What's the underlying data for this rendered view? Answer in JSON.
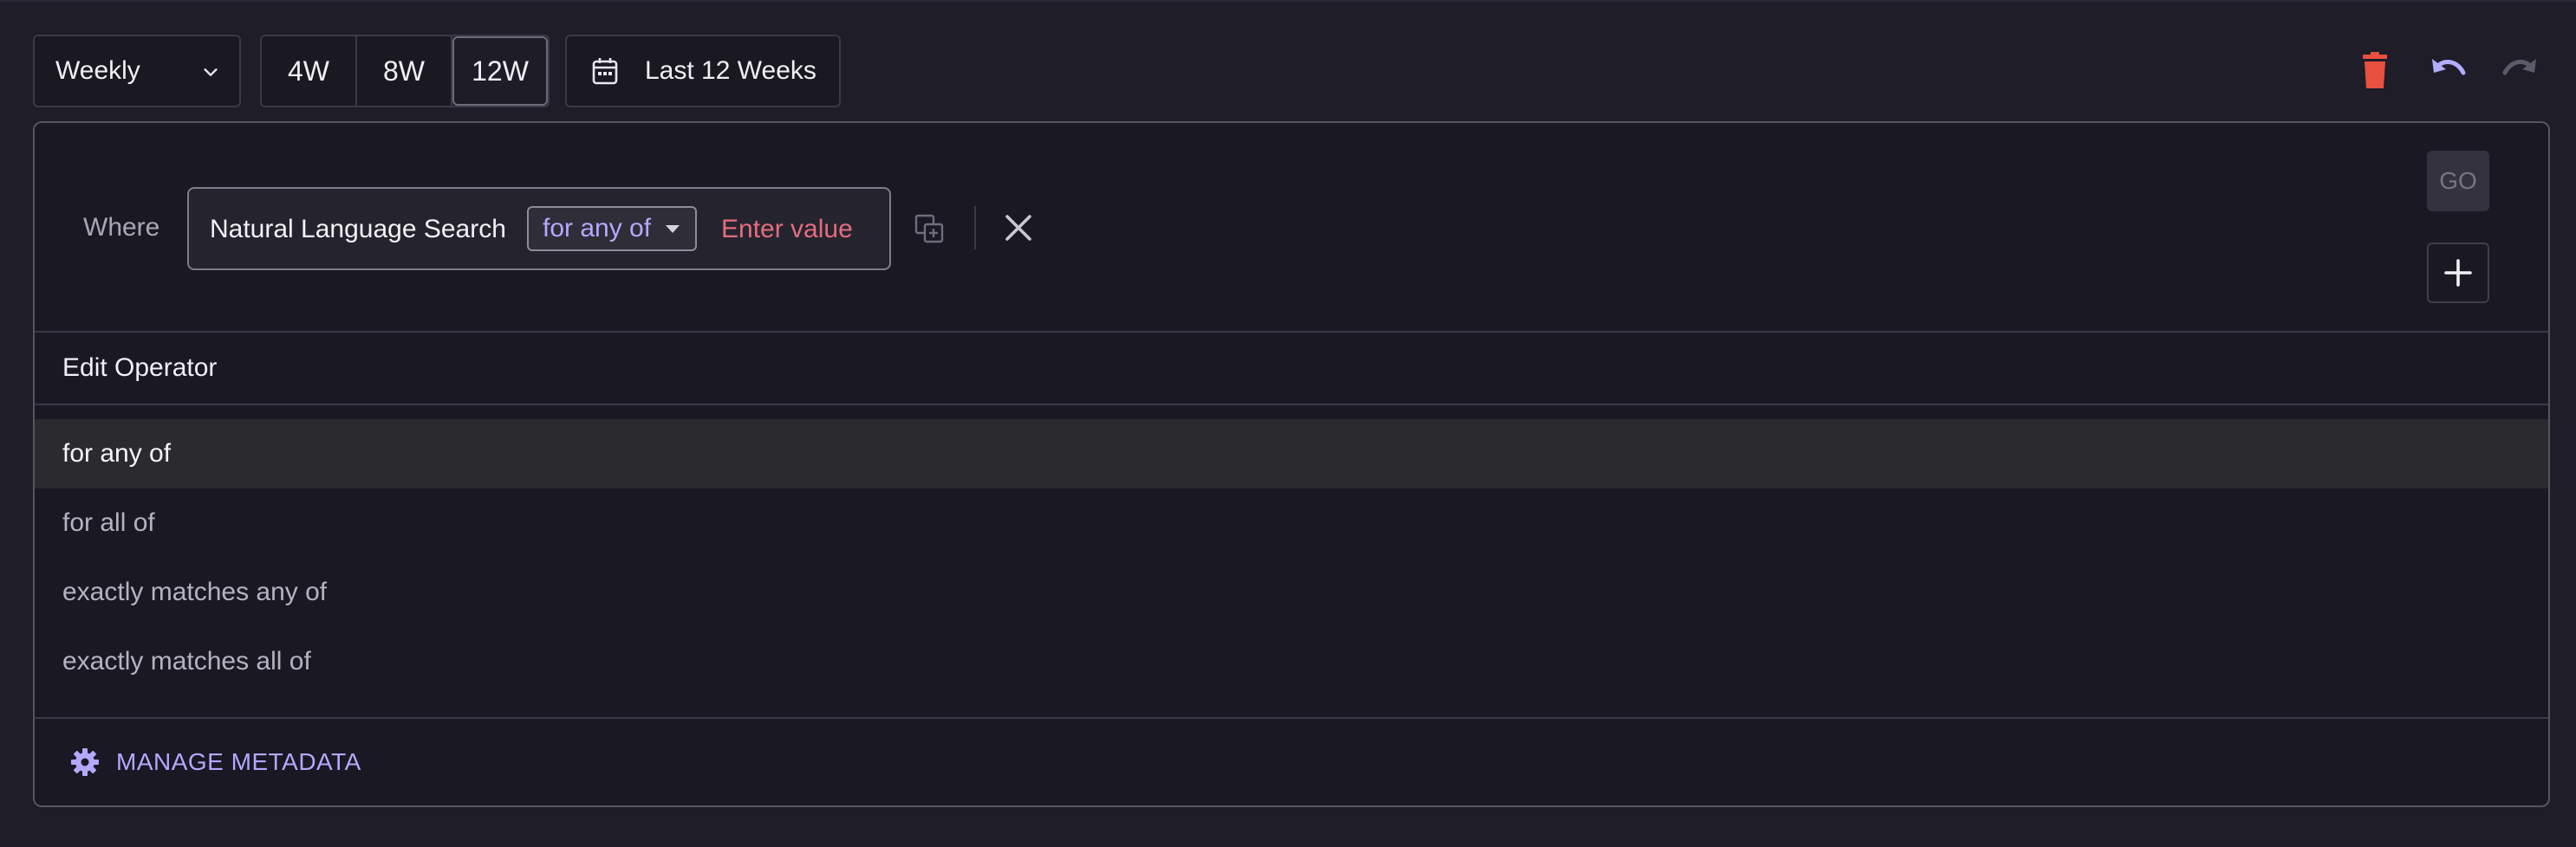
{
  "toolbar": {
    "interval": "Weekly",
    "ranges": [
      "4W",
      "8W",
      "12W"
    ],
    "active_range": "12W",
    "date_range": "Last 12 Weeks"
  },
  "colors": {
    "delete": "#e8503f",
    "undo": "#b3adff",
    "redo": "#5d5b68",
    "accent": "#b7a8ff",
    "value": "#e36d7f"
  },
  "icons": [
    "chevron-down-icon",
    "calendar-icon",
    "trash-icon",
    "undo-icon",
    "redo-icon",
    "duplicate-icon",
    "close-icon",
    "plus-icon",
    "gear-icon",
    "caret-down-icon"
  ],
  "filter": {
    "where_label": "Where",
    "field": "Natural Language Search",
    "operator": "for any of",
    "value_placeholder": "Enter value",
    "go_label": "GO"
  },
  "operator_menu": {
    "title": "Edit Operator",
    "options": [
      "for any of",
      "for all of",
      "exactly matches any of",
      "exactly matches all of"
    ],
    "selected": "for any of"
  },
  "footer": {
    "manage_label": "MANAGE METADATA"
  }
}
